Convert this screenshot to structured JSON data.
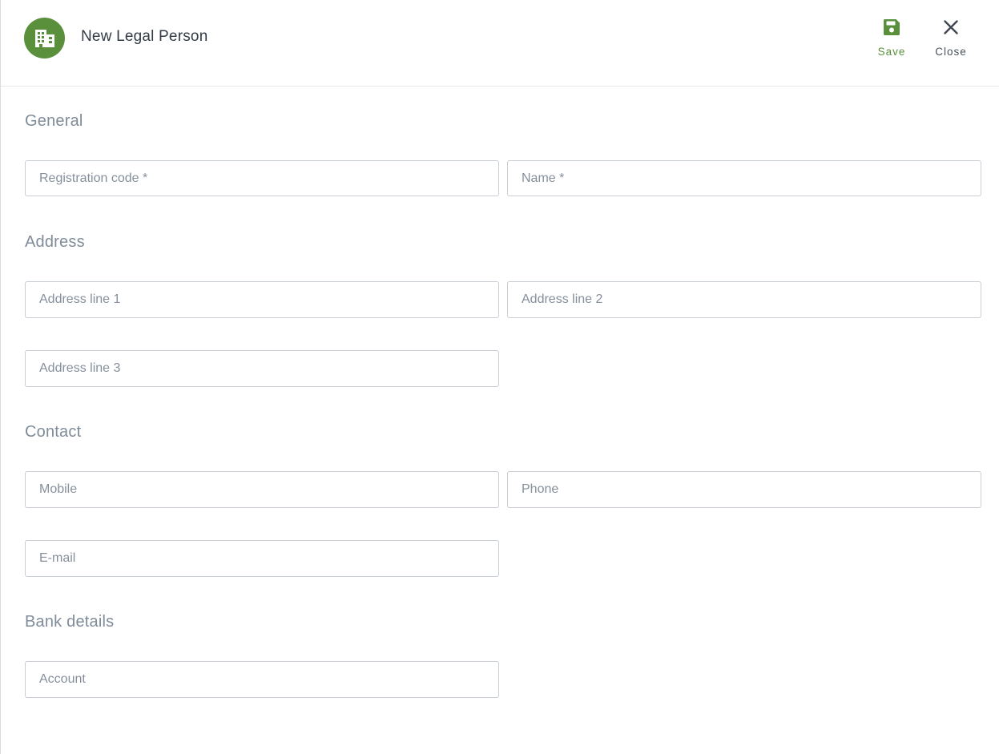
{
  "header": {
    "title": "New Legal Person",
    "avatar_icon": "building-icon",
    "avatar_color": "#5a8f3c",
    "save_label": "Save",
    "close_label": "Close",
    "accent_color": "#5a8f3c"
  },
  "sections": {
    "general": {
      "title": "General",
      "registration_code": {
        "placeholder": "Registration code *",
        "value": ""
      },
      "name": {
        "placeholder": "Name *",
        "value": ""
      }
    },
    "address": {
      "title": "Address",
      "line1": {
        "placeholder": "Address line 1",
        "value": ""
      },
      "line2": {
        "placeholder": "Address line 2",
        "value": ""
      },
      "line3": {
        "placeholder": "Address line 3",
        "value": ""
      }
    },
    "contact": {
      "title": "Contact",
      "mobile": {
        "placeholder": "Mobile",
        "value": ""
      },
      "phone": {
        "placeholder": "Phone",
        "value": ""
      },
      "email": {
        "placeholder": "E-mail",
        "value": ""
      }
    },
    "bank": {
      "title": "Bank details",
      "account": {
        "placeholder": "Account",
        "value": ""
      }
    }
  }
}
